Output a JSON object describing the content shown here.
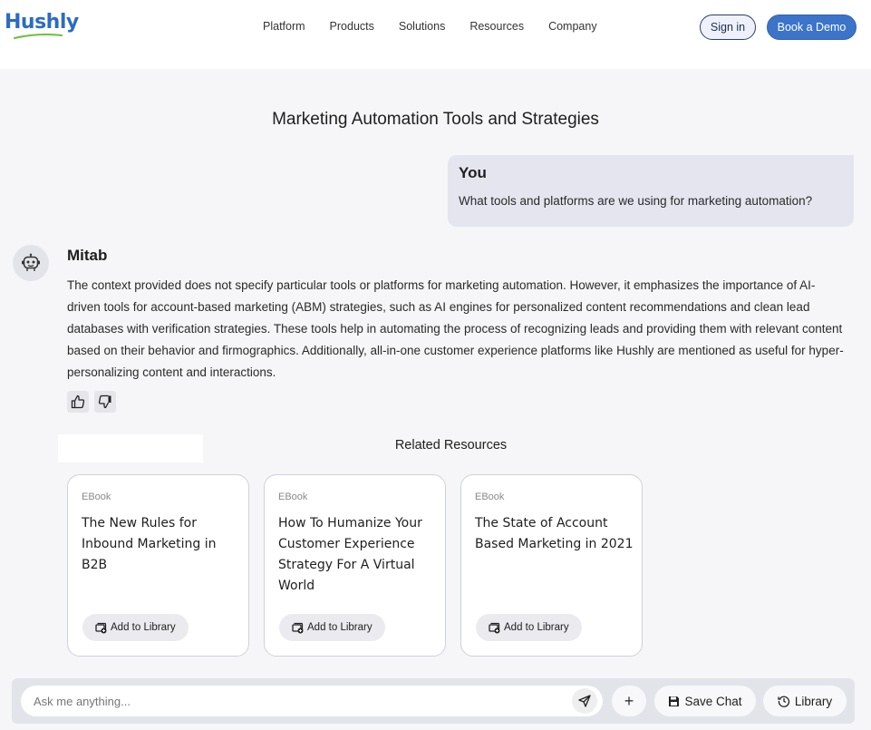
{
  "brand": {
    "logo_text": "Hushly",
    "accent": "#3b74c9",
    "logo_swoosh_color": "#6cbf3f"
  },
  "nav": {
    "items": [
      "Platform",
      "Products",
      "Solutions",
      "Resources",
      "Company"
    ],
    "sign_in": "Sign in",
    "book_demo": "Book a Demo"
  },
  "page": {
    "title": "Marketing Automation Tools and Strategies"
  },
  "user_message": {
    "author": "You",
    "text": "What tools and platforms are we using for marketing automation?"
  },
  "bot_message": {
    "author": "Mitab",
    "avatar_icon": "robot-icon",
    "text": "The context provided does not specify particular tools or platforms for marketing automation. However, it emphasizes the importance of AI-driven tools for account-based marketing (ABM) strategies, such as AI engines for personalized content recommendations and clean lead databases with verification strategies. These tools help in automating the process of recognizing leads and providing them with relevant content based on their behavior and firmographics. Additionally, all-in-one customer experience platforms like Hushly are mentioned as useful for hyper-personalizing content and interactions.",
    "feedback": [
      "thumbs-up-icon",
      "thumbs-down-icon"
    ]
  },
  "related": {
    "title": "Related Resources",
    "cards": [
      {
        "type": "EBook",
        "title": "The New Rules for Inbound Marketing in B2B",
        "button": "Add to Library"
      },
      {
        "type": "EBook",
        "title": "How To Humanize Your Customer Experience Strategy For A Virtual World",
        "button": "Add to Library"
      },
      {
        "type": "EBook",
        "title": "The State of Account Based Marketing in 2021",
        "button": "Add to Library"
      }
    ]
  },
  "composer": {
    "placeholder": "Ask me anything...",
    "plus": "+",
    "save_chat": "Save Chat",
    "library": "Library"
  }
}
